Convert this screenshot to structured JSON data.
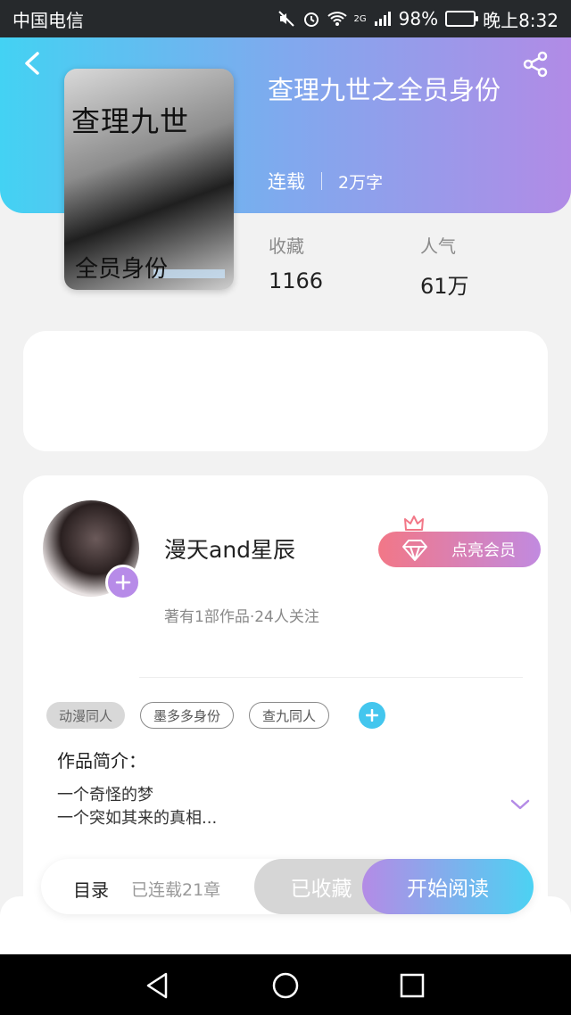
{
  "status_bar": {
    "carrier": "中国电信",
    "network": "2G",
    "battery": "98%",
    "time": "晚上8:32"
  },
  "book": {
    "title": "查理九世之全员身份",
    "status": "连载",
    "word_count": "2万字",
    "cover": {
      "line1": "查理九世",
      "line2": "全员身份"
    },
    "stats": {
      "favorites_label": "收藏",
      "favorites_value": "1166",
      "popularity_label": "人气",
      "popularity_value": "61万"
    }
  },
  "author": {
    "name": "漫天and星辰",
    "summary": "著有1部作品·24人关注",
    "vip_label": "点亮会员"
  },
  "tags": [
    "动漫同人",
    "墨多多身份",
    "查九同人"
  ],
  "intro": {
    "title": "作品简介：",
    "lines": [
      "一个奇怪的梦",
      "一个突如其来的真相..."
    ]
  },
  "bottom_bar": {
    "toc_label": "目录",
    "chapters_label": "已连载21章",
    "collected_label": "已收藏",
    "start_label": "开始阅读"
  },
  "icons": {
    "back": "back-chevron-icon",
    "share": "share-icon",
    "add_follow": "plus-icon",
    "vip": "diamond-icon",
    "crown": "crown-icon",
    "add_tag": "plus-icon",
    "expand": "chevron-down-icon"
  },
  "colors": {
    "header_gradient": [
      "#43d2f3",
      "#80a9ee",
      "#b18be6"
    ],
    "vip_gradient": [
      "#f27787",
      "#c18ae0"
    ],
    "start_gradient": [
      "#b48be6",
      "#4cd2f3"
    ],
    "accent_purple": "#b78be8",
    "accent_cyan": "#43c6ee"
  }
}
